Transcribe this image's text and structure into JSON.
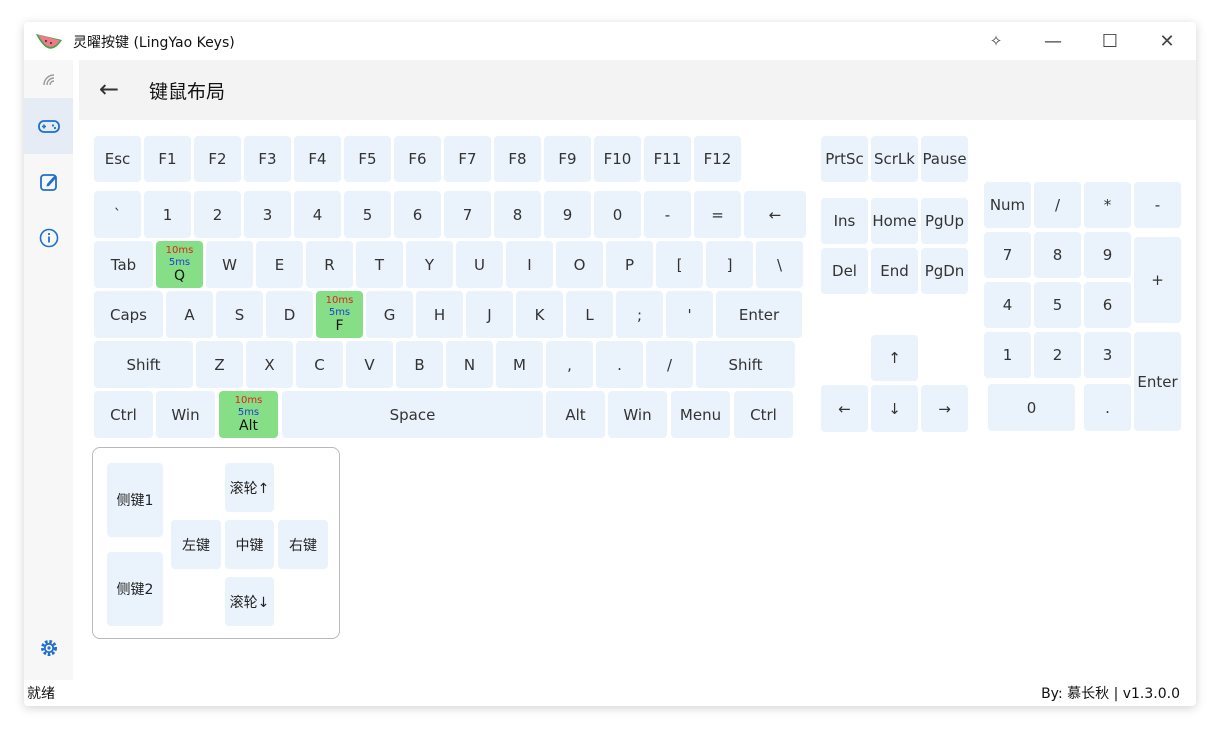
{
  "app": {
    "title": "灵曜按键 (LingYao Keys)"
  },
  "header": {
    "title": "键鼠布局",
    "back_arrow": "←"
  },
  "titlebar": {
    "pin": "✧",
    "minimize": "—",
    "maximize": "☐",
    "close": "✕"
  },
  "status": {
    "left": "就绪",
    "right": "By: 慕长秋 | v1.3.0.0"
  },
  "keyboard": {
    "fn_row": [
      "Esc",
      "F1",
      "F2",
      "F3",
      "F4",
      "F5",
      "F6",
      "F7",
      "F8",
      "F9",
      "F10",
      "F11",
      "F12"
    ],
    "sys_row": [
      "PrtSc",
      "ScrLk",
      "Pause"
    ],
    "num_row": [
      "`",
      "1",
      "2",
      "3",
      "4",
      "5",
      "6",
      "7",
      "8",
      "9",
      "0",
      "-",
      "=",
      "←"
    ],
    "tab_row": [
      "Tab",
      "Q",
      "W",
      "E",
      "R",
      "T",
      "Y",
      "U",
      "I",
      "O",
      "P",
      "[",
      "]",
      "\\"
    ],
    "caps_row": [
      "Caps",
      "A",
      "S",
      "D",
      "F",
      "G",
      "H",
      "J",
      "K",
      "L",
      ";",
      "'",
      "Enter"
    ],
    "shift_row": [
      "Shift",
      "Z",
      "X",
      "C",
      "V",
      "B",
      "N",
      "M",
      ",",
      ".",
      "/",
      "Shift"
    ],
    "ctrl_row": [
      "Ctrl",
      "Win",
      "Alt",
      "Space",
      "Alt",
      "Win",
      "Menu",
      "Ctrl"
    ],
    "nav_top": [
      "Ins",
      "Home",
      "PgUp"
    ],
    "nav_bottom": [
      "Del",
      "End",
      "PgDn"
    ],
    "arrows": [
      "↑",
      "←",
      "↓",
      "→"
    ],
    "numpad": [
      "Num",
      "/",
      "*",
      "-",
      "7",
      "8",
      "9",
      "+",
      "4",
      "5",
      "6",
      "1",
      "2",
      "3",
      "Enter",
      "0",
      "."
    ],
    "bound": {
      "q": {
        "t1": "10ms",
        "t2": "5ms",
        "label": "Q"
      },
      "f": {
        "t1": "10ms",
        "t2": "5ms",
        "label": "F"
      },
      "alt": {
        "t1": "10ms",
        "t2": "5ms",
        "label": "Alt"
      }
    }
  },
  "mouse": {
    "side1": "侧键1",
    "side2": "侧键2",
    "wheel_up": "滚轮↑",
    "wheel_down": "滚轮↓",
    "left": "左键",
    "middle": "中键",
    "right": "右键"
  },
  "colors": {
    "key_bg": "#eaf3fb",
    "bound_bg": "#86df86",
    "accent": "#1e6fd0"
  }
}
